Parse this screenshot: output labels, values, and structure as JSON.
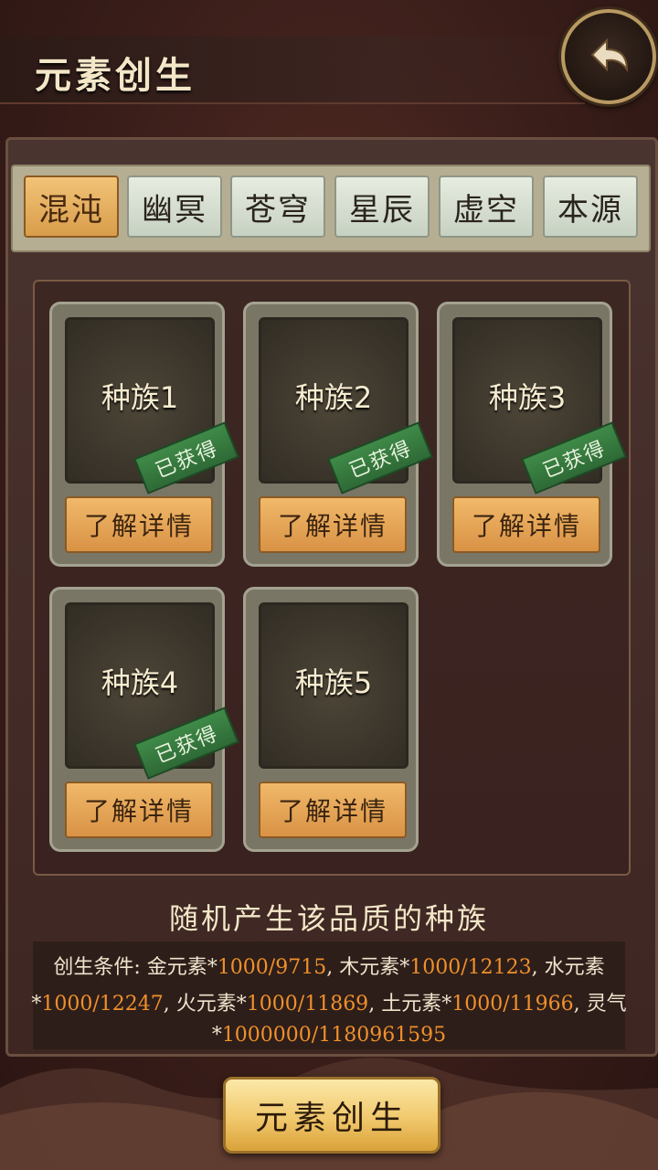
{
  "header": {
    "title": "元素创生"
  },
  "tabs": [
    {
      "label": "混沌",
      "active": true
    },
    {
      "label": "幽冥",
      "active": false
    },
    {
      "label": "苍穹",
      "active": false
    },
    {
      "label": "星辰",
      "active": false
    },
    {
      "label": "虚空",
      "active": false
    },
    {
      "label": "本源",
      "active": false
    }
  ],
  "races": [
    {
      "name": "种族1",
      "badge": "已获得",
      "detail_label": "了解详情"
    },
    {
      "name": "种族2",
      "badge": "已获得",
      "detail_label": "了解详情"
    },
    {
      "name": "种族3",
      "badge": "已获得",
      "detail_label": "了解详情"
    },
    {
      "name": "种族4",
      "badge": "已获得",
      "detail_label": "了解详情"
    },
    {
      "name": "种族5",
      "badge": "",
      "detail_label": "了解详情"
    }
  ],
  "description": "随机产生该品质的种族",
  "conditions": {
    "prefix": "创生条件:",
    "items": [
      {
        "name": "金元素",
        "value": "1000/9715"
      },
      {
        "name": "木元素",
        "value": "1000/12123"
      },
      {
        "name": "水元素",
        "value": "1000/12247"
      },
      {
        "name": "火元素",
        "value": "1000/11869"
      },
      {
        "name": "土元素",
        "value": "1000/11966"
      },
      {
        "name": "灵气",
        "value": "1000000/1180961595"
      }
    ]
  },
  "action": {
    "create_label": "元素创生"
  },
  "colors": {
    "accent_number": "#f0902a",
    "badge_green": "#3f8a48",
    "active_tab": "#e8b060"
  }
}
